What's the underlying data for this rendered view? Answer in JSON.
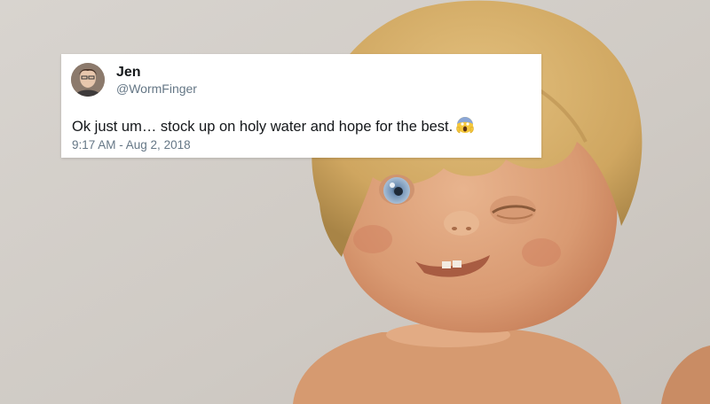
{
  "tweet": {
    "author_name": "Jen",
    "author_handle": "@WormFinger",
    "text": "Ok just um… stock up on holy water and hope for the best.",
    "emoji": "face-screaming-in-fear-icon",
    "timestamp": "9:17 AM - Aug 2, 2018"
  },
  "colors": {
    "background": "#d6d2cd",
    "card": "#ffffff",
    "text_primary": "#14171a",
    "text_secondary": "#657786"
  }
}
